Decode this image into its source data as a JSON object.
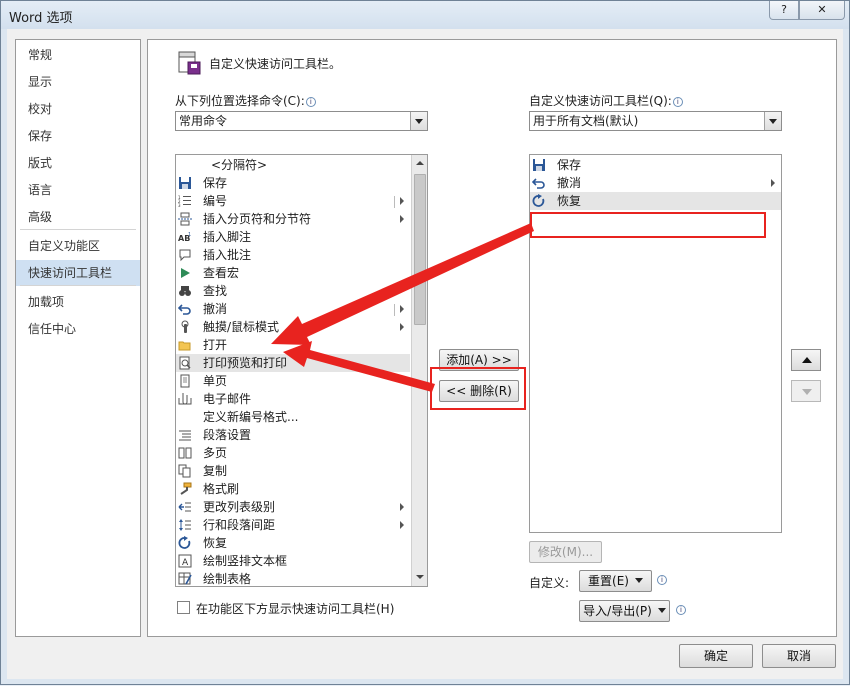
{
  "window": {
    "title": "Word 选项",
    "help": "?",
    "close": "✕"
  },
  "nav": {
    "items": [
      {
        "label": "常规",
        "active": false
      },
      {
        "label": "显示",
        "active": false
      },
      {
        "label": "校对",
        "active": false
      },
      {
        "label": "保存",
        "active": false
      },
      {
        "label": "版式",
        "active": false
      },
      {
        "label": "语言",
        "active": false
      },
      {
        "label": "高级",
        "active": false
      },
      {
        "label": "自定义功能区",
        "active": false
      },
      {
        "label": "快速访问工具栏",
        "active": true
      },
      {
        "label": "加载项",
        "active": false
      },
      {
        "label": "信任中心",
        "active": false
      }
    ]
  },
  "main": {
    "header": "自定义快速访问工具栏。",
    "choose_from_label": "从下列位置选择命令(C):",
    "choose_from_value": "常用命令",
    "customize_label": "自定义快速访问工具栏(Q):",
    "customize_value": "用于所有文档(默认)",
    "commands": [
      {
        "label": "<分隔符>",
        "icon": "separator",
        "sub": "sep"
      },
      {
        "label": "保存",
        "icon": "save",
        "sub": ""
      },
      {
        "label": "编号",
        "icon": "numbering",
        "sub": "split"
      },
      {
        "label": "插入分页符和分节符",
        "icon": "page-break",
        "sub": "arrow"
      },
      {
        "label": "插入脚注",
        "icon": "footnote",
        "sub": ""
      },
      {
        "label": "插入批注",
        "icon": "comment",
        "sub": ""
      },
      {
        "label": "查看宏",
        "icon": "macro",
        "sub": ""
      },
      {
        "label": "查找",
        "icon": "find",
        "sub": ""
      },
      {
        "label": "撤消",
        "icon": "undo",
        "sub": "split"
      },
      {
        "label": "触摸/鼠标模式",
        "icon": "touch",
        "sub": "arrow"
      },
      {
        "label": "打开",
        "icon": "open",
        "sub": ""
      },
      {
        "label": "打印预览和打印",
        "icon": "print-preview",
        "sub": "",
        "selected": true
      },
      {
        "label": "单页",
        "icon": "one-page",
        "sub": ""
      },
      {
        "label": "电子邮件",
        "icon": "email",
        "sub": ""
      },
      {
        "label": "定义新编号格式...",
        "icon": "",
        "sub": ""
      },
      {
        "label": "段落设置",
        "icon": "paragraph",
        "sub": ""
      },
      {
        "label": "多页",
        "icon": "multi-page",
        "sub": ""
      },
      {
        "label": "复制",
        "icon": "copy",
        "sub": ""
      },
      {
        "label": "格式刷",
        "icon": "format-painter",
        "sub": ""
      },
      {
        "label": "更改列表级别",
        "icon": "list-level",
        "sub": "arrow"
      },
      {
        "label": "行和段落间距",
        "icon": "line-spacing",
        "sub": "arrow"
      },
      {
        "label": "恢复",
        "icon": "redo",
        "sub": ""
      },
      {
        "label": "绘制竖排文本框",
        "icon": "vertical-textbox",
        "sub": ""
      },
      {
        "label": "绘制表格",
        "icon": "draw-table",
        "sub": ""
      }
    ],
    "toolbar_items": [
      {
        "label": "保存",
        "icon": "save",
        "sub": ""
      },
      {
        "label": "撤消",
        "icon": "undo",
        "sub": "arrow"
      },
      {
        "label": "恢复",
        "icon": "redo",
        "sub": "",
        "selected": true
      }
    ],
    "add_button": "添加(A) >>",
    "remove_button": "<< 删除(R)",
    "modify_button": "修改(M)...",
    "customize_caption": "自定义:",
    "reset_button": "重置(E)",
    "import_export_button": "导入/导出(P)",
    "show_below_ribbon": "在功能区下方显示快速访问工具栏(H)"
  },
  "footer": {
    "ok": "确定",
    "cancel": "取消"
  },
  "colors": {
    "annotation": "#e8231f",
    "nav_active": "#cfe0f2",
    "icon_blue": "#2b5797"
  }
}
